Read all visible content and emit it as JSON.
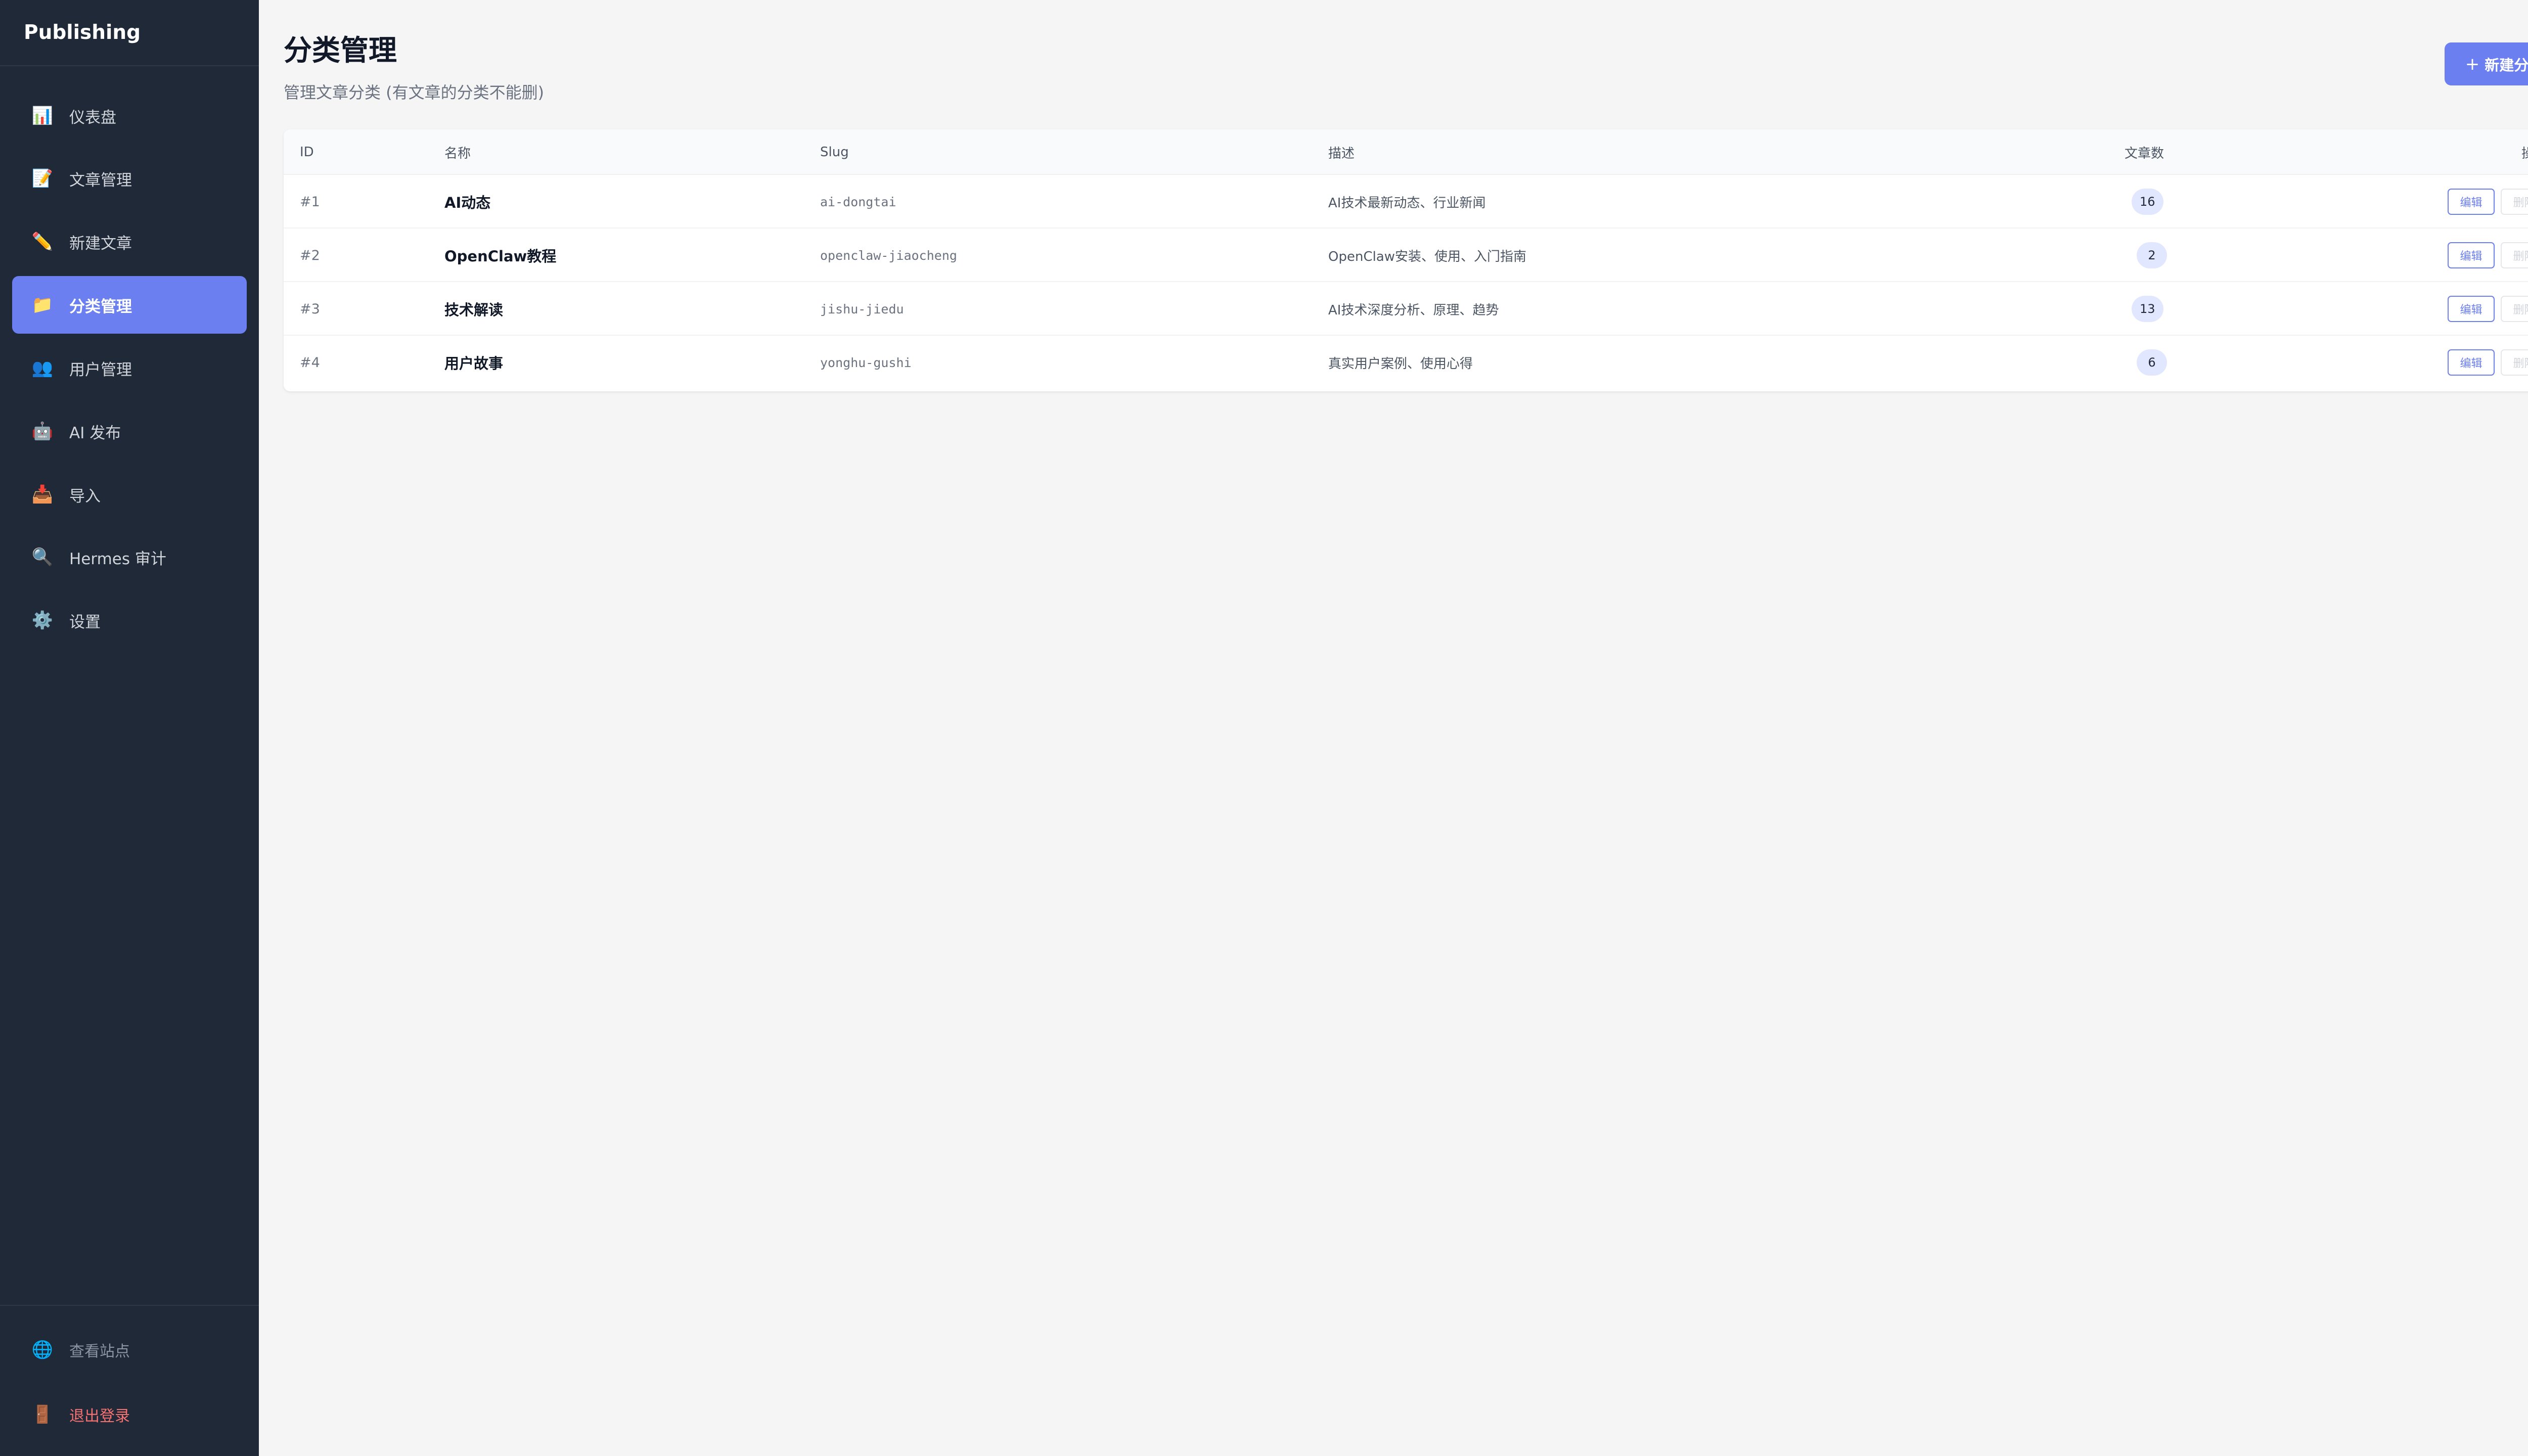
{
  "sidebar": {
    "brand": "Publishing",
    "items": [
      {
        "label": "仪表盘",
        "icon": "📊",
        "icon_name": "chart-icon"
      },
      {
        "label": "文章管理",
        "icon": "📝",
        "icon_name": "memo-icon"
      },
      {
        "label": "新建文章",
        "icon": "✏️",
        "icon_name": "pencil-icon"
      },
      {
        "label": "分类管理",
        "icon": "📁",
        "icon_name": "folder-icon",
        "active": true
      },
      {
        "label": "用户管理",
        "icon": "👥",
        "icon_name": "users-icon"
      },
      {
        "label": "AI 发布",
        "icon": "🤖",
        "icon_name": "robot-icon"
      },
      {
        "label": "导入",
        "icon": "📥",
        "icon_name": "inbox-icon"
      },
      {
        "label": "Hermes 审计",
        "icon": "🔍",
        "icon_name": "magnifier-icon"
      },
      {
        "label": "设置",
        "icon": "⚙️",
        "icon_name": "gear-icon"
      }
    ],
    "bottom": {
      "view_site": {
        "label": "查看站点",
        "icon": "🌐",
        "icon_name": "globe-icon"
      },
      "logout": {
        "label": "退出登录",
        "icon": "🚪",
        "icon_name": "door-icon"
      }
    }
  },
  "header": {
    "title": "分类管理",
    "subtitle": "管理文章分类 (有文章的分类不能删)",
    "new_button": {
      "label": "新建分类",
      "icon": "+"
    }
  },
  "table": {
    "columns": {
      "id": "ID",
      "name": "名称",
      "slug": "Slug",
      "description": "描述",
      "count": "文章数",
      "actions": "操作"
    },
    "rows": [
      {
        "id": "#1",
        "name": "AI动态",
        "slug": "ai-dongtai",
        "description": "AI技术最新动态、行业新闻",
        "count": "16",
        "edit": "编辑",
        "delete": "删除"
      },
      {
        "id": "#2",
        "name": "OpenClaw教程",
        "slug": "openclaw-jiaocheng",
        "description": "OpenClaw安装、使用、入门指南",
        "count": "2",
        "edit": "编辑",
        "delete": "删除"
      },
      {
        "id": "#3",
        "name": "技术解读",
        "slug": "jishu-jiedu",
        "description": "AI技术深度分析、原理、趋势",
        "count": "13",
        "edit": "编辑",
        "delete": "删除"
      },
      {
        "id": "#4",
        "name": "用户故事",
        "slug": "yonghu-gushi",
        "description": "真实用户案例、使用心得",
        "count": "6",
        "edit": "编辑",
        "delete": "删除"
      }
    ]
  },
  "colors": {
    "sidebar_bg": "#1f2937",
    "accent": "#6b7ff0",
    "logout": "#f87171",
    "badge_bg": "#e0e7ff"
  }
}
